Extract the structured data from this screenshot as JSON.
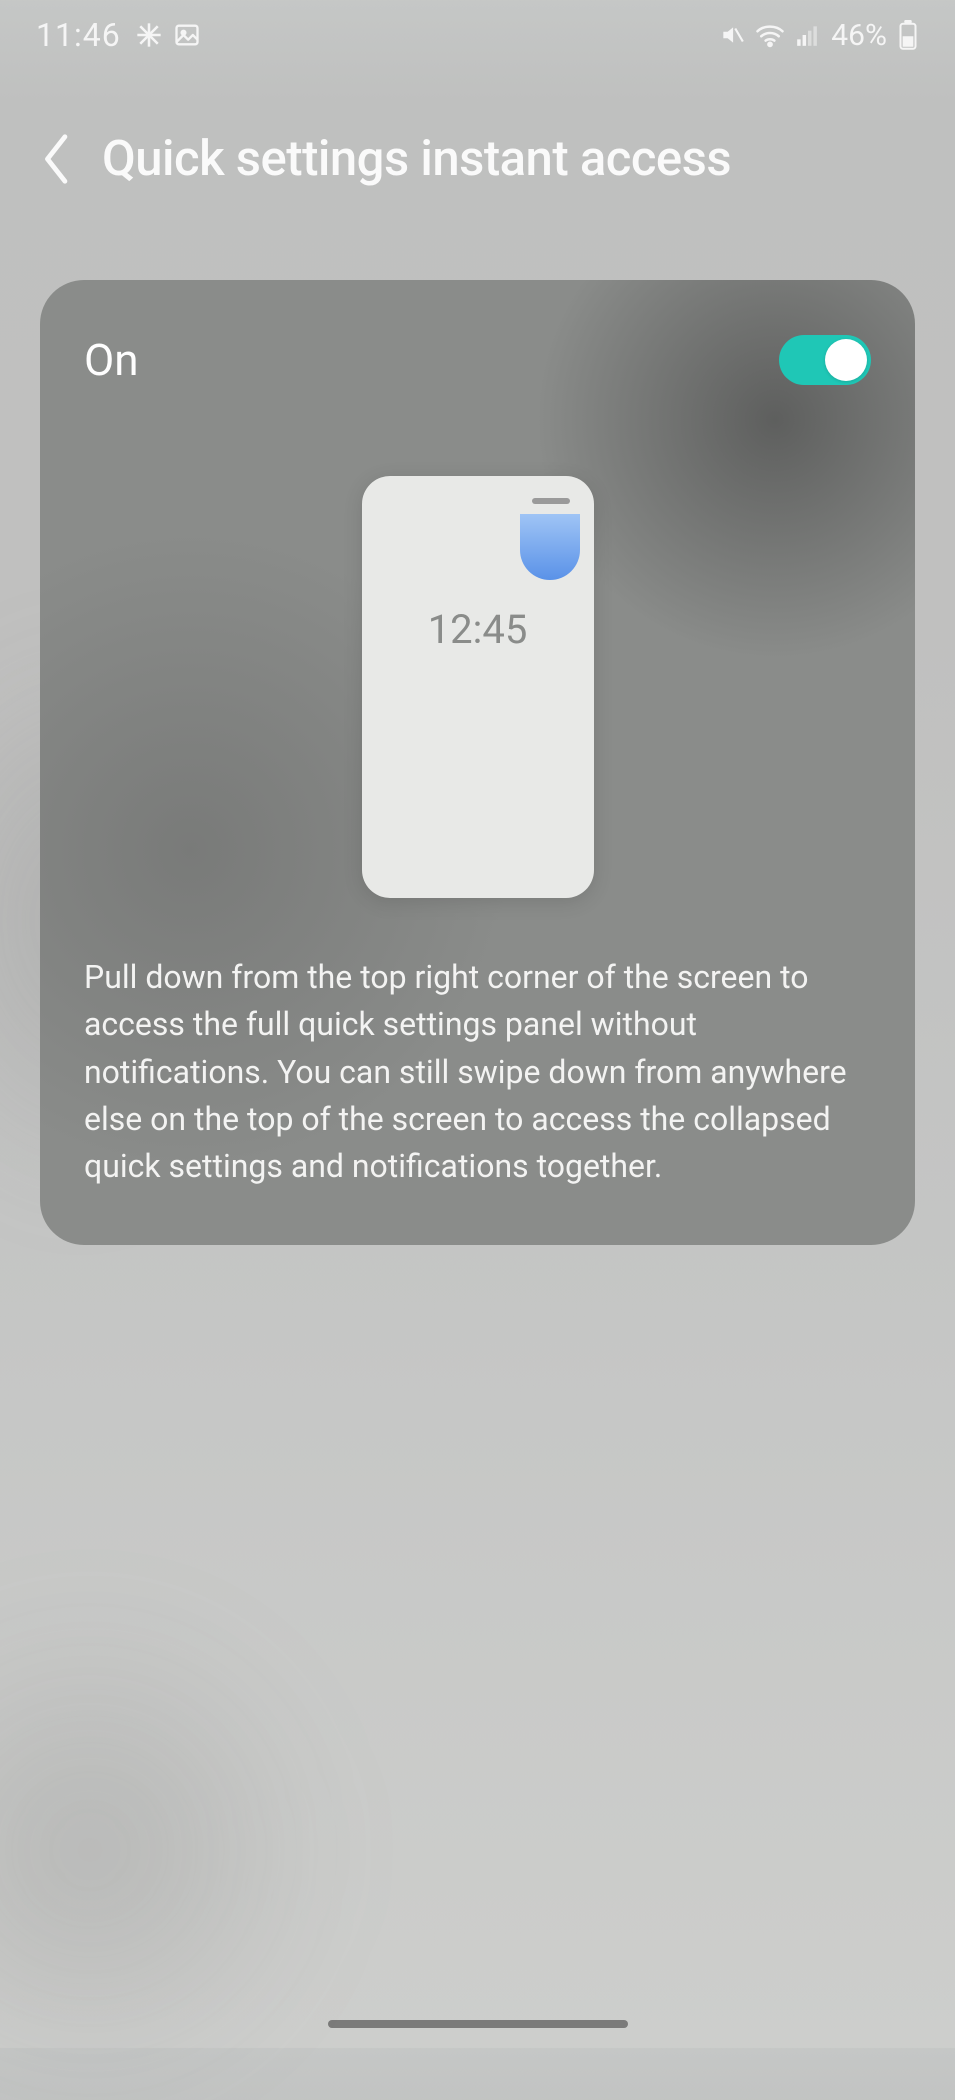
{
  "statusbar": {
    "time": "11:46",
    "battery_percent": "46%",
    "icons_left": [
      "slack",
      "gallery"
    ],
    "icons_right": [
      "mute-vibrate",
      "wifi",
      "signal"
    ]
  },
  "header": {
    "title": "Quick settings instant access"
  },
  "card": {
    "toggle_label": "On",
    "toggle_on": true,
    "illustration_time": "12:45",
    "description": "Pull down from the top right corner of the screen to access the full quick settings panel without notifications. You can still swipe down from anywhere else on the top of the screen to access the collapsed quick settings and notifications together."
  },
  "colors": {
    "toggle_on": "#1fc7b6",
    "illus_blue_top": "#9fc4f5",
    "illus_blue_bottom": "#5a92e8"
  }
}
